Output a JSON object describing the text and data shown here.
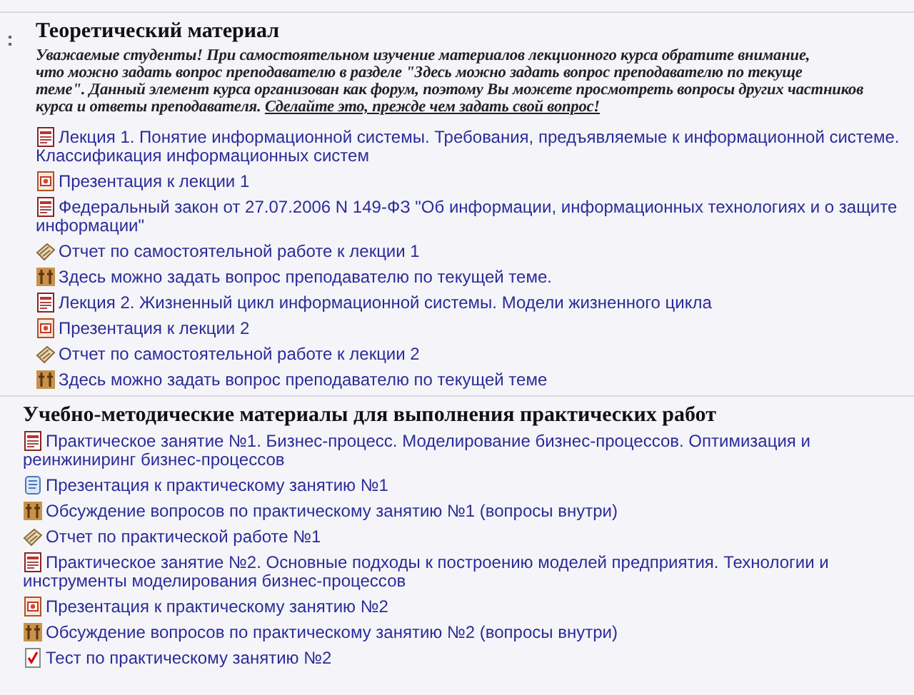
{
  "sections": [
    {
      "title": "Теоретический материал",
      "has_handle": true,
      "intro": {
        "lines": [
          "Уважаемые студенты! При самостоятельном изучение материалов лекционного курса обратите внимание,",
          "что можно задать вопрос преподавателю в разделе \"Здесь можно задать вопрос преподавателю по текуще",
          "теме\". Данный элемент курса организован как форум, поэтому Вы можете просмотреть вопросы других частников",
          "курса и ответы преподавателя."
        ],
        "link": "Сделайте это, прежде чем задать свой вопрос!"
      },
      "items": [
        {
          "kind": "pdf",
          "text": "Лекция 1. Понятие информационной системы. Требования, предъявляемые к информационной системе. Классификация информационных систем"
        },
        {
          "kind": "ppt",
          "text": "Презентация к лекции 1"
        },
        {
          "kind": "pdf",
          "text": "Федеральный закон от 27.07.2006 N 149-ФЗ \"Об информации, информационных технологиях и о защите информации\""
        },
        {
          "kind": "assignment",
          "text": "Отчет по самостоятельной работе к лекции 1"
        },
        {
          "kind": "forum",
          "text": "Здесь можно задать вопрос преподавателю по текущей теме."
        },
        {
          "kind": "pdf",
          "text": "Лекция 2. Жизненный цикл информационной системы. Модели жизненного цикла"
        },
        {
          "kind": "ppt",
          "text": "Презентация к лекции 2"
        },
        {
          "kind": "assignment",
          "text": "Отчет по самостоятельной работе к лекции 2"
        },
        {
          "kind": "forum",
          "text": "Здесь можно задать вопрос преподавателю по текущей теме"
        }
      ]
    },
    {
      "title": "Учебно-методические материалы для выполнения практических работ",
      "has_handle": false,
      "items": [
        {
          "kind": "pdf",
          "text": "Практическое занятие №1. Бизнес-процесс. Моделирование бизнес-процессов. Оптимизация и реинжиниринг бизнес-процессов"
        },
        {
          "kind": "doc",
          "text": "Презентация к практическому занятию №1"
        },
        {
          "kind": "forum",
          "text": "Обсуждение вопросов по практическому занятию №1 (вопросы внутри)"
        },
        {
          "kind": "assignment",
          "text": "Отчет по практической работе №1"
        },
        {
          "kind": "pdf",
          "text": "Практическое занятие №2. Основные подходы к построению моделей предприятия. Технологии и инструменты моделирования бизнес-процессов"
        },
        {
          "kind": "ppt",
          "text": "Презентация к практическому занятию №2"
        },
        {
          "kind": "forum",
          "text": "Обсуждение вопросов по практическому занятию №2 (вопросы внутри)"
        },
        {
          "kind": "quiz",
          "text": "Тест по практическому занятию №2"
        }
      ]
    }
  ]
}
